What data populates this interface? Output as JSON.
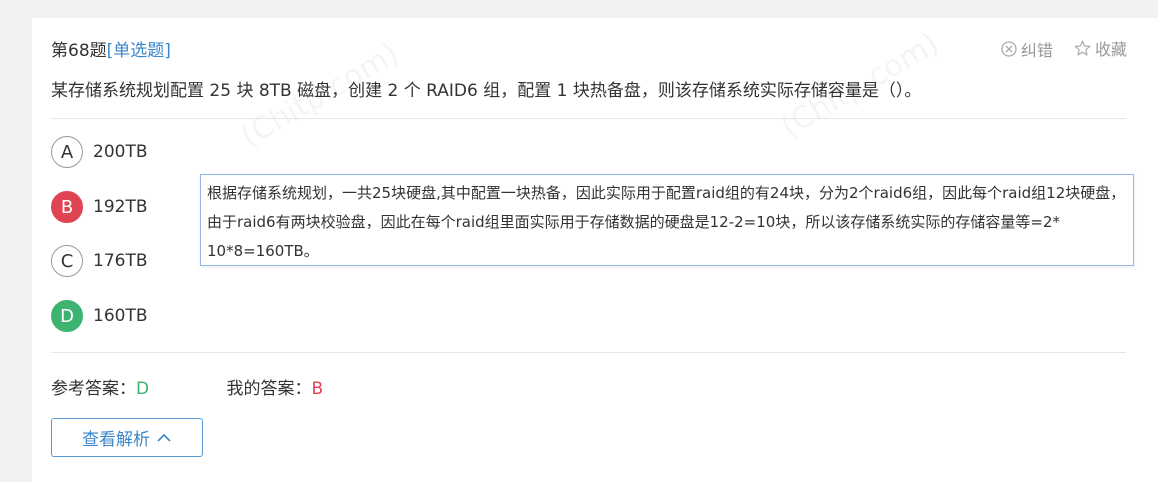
{
  "question": {
    "number_label": "第68题",
    "type_label": "[单选题]",
    "stem": "某存储系统规划配置 25 块 8TB 磁盘，创建 2 个 RAID6 组，配置 1 块热备盘，则该存储系统实际存储容量是（）。"
  },
  "actions": {
    "report_label": "纠错",
    "favorite_label": "收藏"
  },
  "options": [
    {
      "letter": "A",
      "text": "200TB",
      "state": "normal"
    },
    {
      "letter": "B",
      "text": "192TB",
      "state": "wrong"
    },
    {
      "letter": "C",
      "text": "176TB",
      "state": "normal"
    },
    {
      "letter": "D",
      "text": "160TB",
      "state": "correct"
    }
  ],
  "explanation": "根据存储系统规划，一共25块硬盘,其中配置一块热备，因此实际用于配置raid组的有24块，分为2个raid6组，因此每个raid组12块硬盘，由于raid6有两块校验盘，因此在每个raid组里面实际用于存储数据的硬盘是12-2=10块，所以该存储系统实际的存储容量等=2* 10*8=160TB。",
  "answers": {
    "reference_label": "参考答案：",
    "reference_value": "D",
    "mine_label": "我的答案：",
    "mine_value": "B"
  },
  "view_analysis_button": "查看解析",
  "colors": {
    "accent": "#3b86c9",
    "correct": "#3cb371",
    "wrong": "#e04452"
  }
}
